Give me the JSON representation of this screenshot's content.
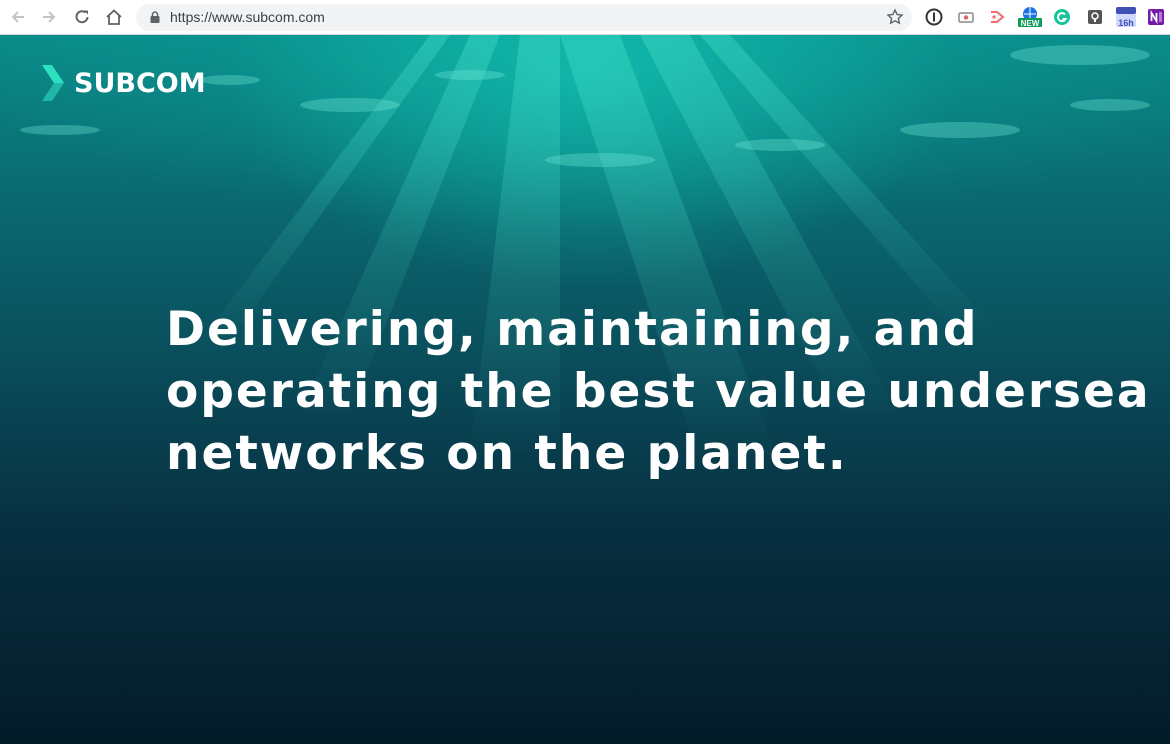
{
  "browser": {
    "url": "https://www.subcom.com",
    "extensions": [
      {
        "name": "1password-icon",
        "badge": ""
      },
      {
        "name": "screen-capture-icon",
        "badge": ""
      },
      {
        "name": "cast-icon",
        "badge": ""
      },
      {
        "name": "globe-new-icon",
        "badge": "NEW"
      },
      {
        "name": "grammarly-icon",
        "badge": ""
      },
      {
        "name": "keep-icon",
        "badge": ""
      },
      {
        "name": "calendar-icon",
        "badge": "16h"
      },
      {
        "name": "onenote-icon",
        "badge": ""
      }
    ]
  },
  "site": {
    "logo_text": "SUBCOM",
    "headline_lines": [
      "Delivering, maintaining, and",
      "operating the best value undersea",
      "networks on the planet."
    ]
  },
  "colors": {
    "accent": "#2de0c0",
    "text": "#ffffff",
    "water_top": "#0a8a88",
    "water_bottom": "#041b28"
  }
}
